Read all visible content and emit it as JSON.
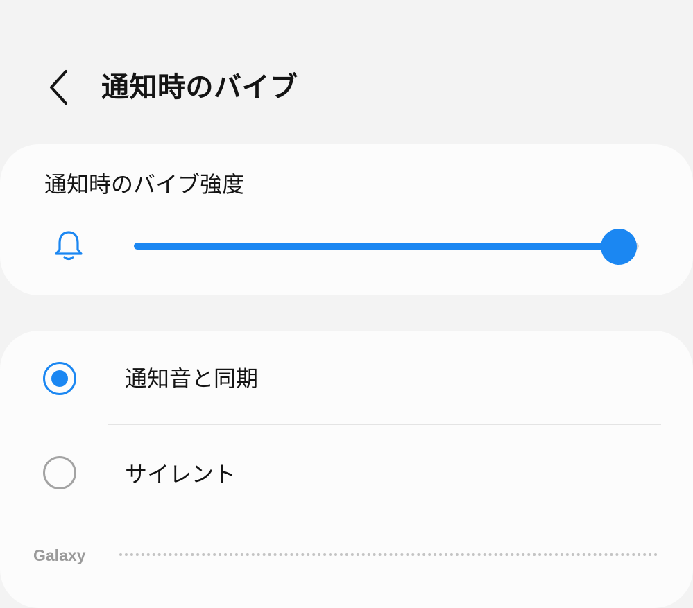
{
  "header": {
    "title": "通知時のバイブ",
    "back_icon": "chevron-left-icon"
  },
  "intensity": {
    "label": "通知時のバイブ強度",
    "icon": "bell-icon",
    "level_percent": 96,
    "accent_color": "#1b87f2"
  },
  "options": [
    {
      "label": "通知音と同期",
      "selected": true
    },
    {
      "label": "サイレント",
      "selected": false
    }
  ],
  "watermark": {
    "text": "Galaxy"
  }
}
